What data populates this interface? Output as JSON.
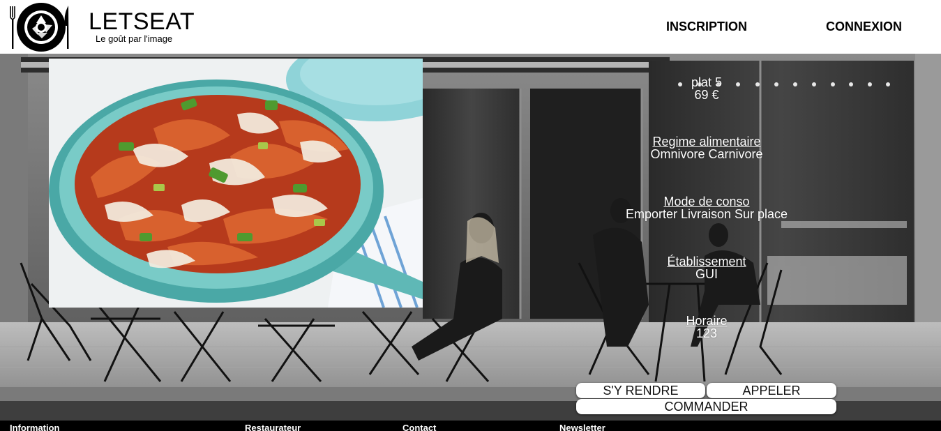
{
  "brand": {
    "name": "LETSEAT",
    "tagline": "Le goût par l'image",
    "logo_icon": "plate-fork-knife-icon"
  },
  "nav": {
    "inscription": "INSCRIPTION",
    "connexion": "CONNEXION"
  },
  "dish": {
    "name": "plat 5",
    "price": "69 €",
    "photo_icon": "lasagna-skillet-photo"
  },
  "details": {
    "regime": {
      "title": "Regime alimentaire",
      "value": "Omnivore Carnivore"
    },
    "mode": {
      "title": "Mode de conso",
      "value": "Emporter Livraison Sur place"
    },
    "etablissement": {
      "title": "Établissement",
      "value": "GUI"
    },
    "horaire": {
      "title": "Horaire",
      "value": "123"
    }
  },
  "actions": {
    "rendre": "S'Y RENDRE",
    "appeler": "APPELER",
    "commander": "COMMANDER"
  },
  "footer": {
    "information": "Information",
    "restaurateur": "Restaurateur",
    "contact": "Contact",
    "newsletter": "Newsletter"
  },
  "colors": {
    "header_bg": "#ffffff",
    "footer_bg": "#000000",
    "hero_tint": "#6d6d6d",
    "pan_teal": "#7cc8c4",
    "sauce_red": "#c2401f"
  }
}
